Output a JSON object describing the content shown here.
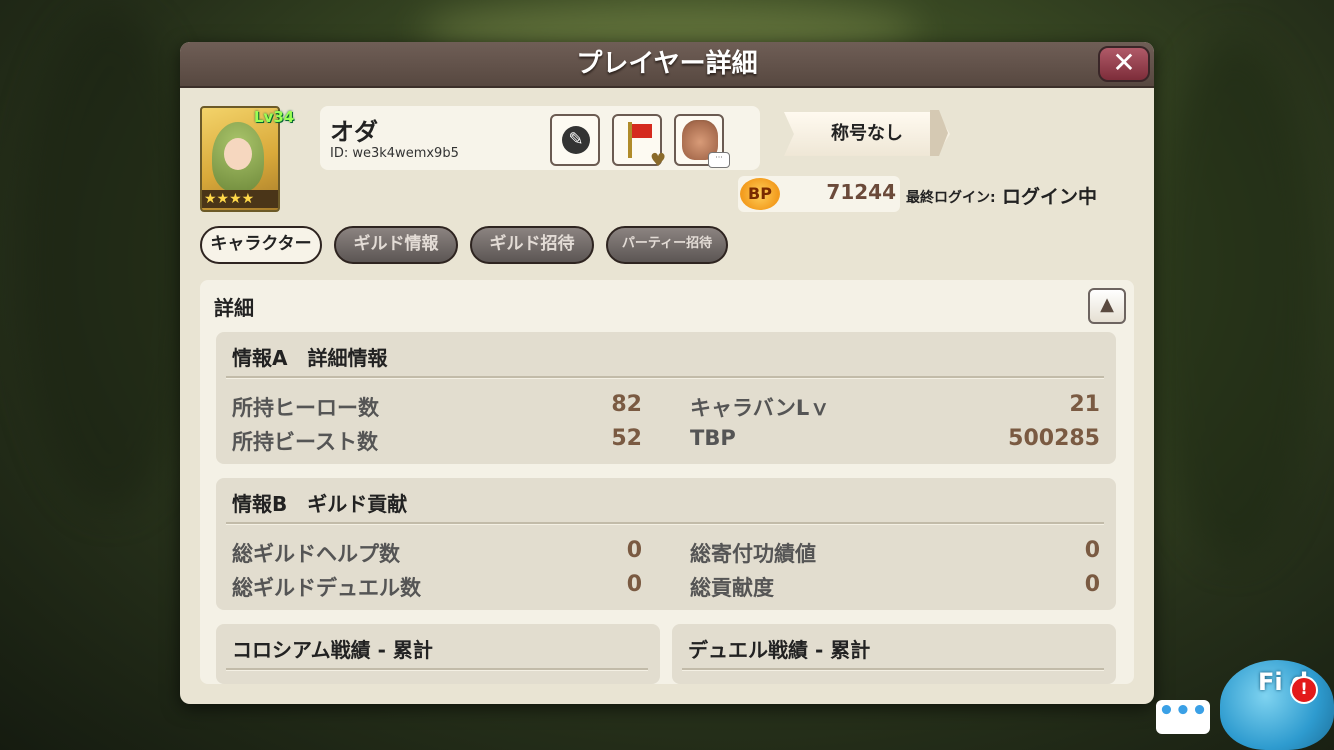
{
  "dialog": {
    "title": "プレイヤー詳細",
    "close_label": "✕"
  },
  "player": {
    "level_badge": "Lv34",
    "stars": "★★★★",
    "name": "オダ",
    "id": "ID: we3k4wemx9b5",
    "title_badge": "称号なし",
    "bp_icon": "BP",
    "bp_value": "71244",
    "login_label": "最終ログイン:",
    "login_status": "ログイン中"
  },
  "action_icons": [
    "pen-icon",
    "guild-flag-icon",
    "chat-portrait-icon"
  ],
  "tabs": [
    {
      "label": "キャラクター",
      "active": true
    },
    {
      "label": "ギルド情報",
      "active": false
    },
    {
      "label": "ギルド招待",
      "active": false
    },
    {
      "label": "パーティー招待",
      "active": false
    }
  ],
  "details": {
    "label": "詳細",
    "collapse_label": "▲",
    "info_a": {
      "header": "情報A　詳細情報",
      "stats": [
        {
          "label": "所持ヒーロー数",
          "value": "82"
        },
        {
          "label": "所持ビースト数",
          "value": "52"
        },
        {
          "label": "キャラバンLｖ",
          "value": "21"
        },
        {
          "label": "TBP",
          "value": "500285"
        }
      ]
    },
    "info_b": {
      "header": "情報B　ギルド貢献",
      "stats": [
        {
          "label": "総ギルドヘルプ数",
          "value": "0"
        },
        {
          "label": "総ギルドデュエル数",
          "value": "0"
        },
        {
          "label": "総寄付功績値",
          "value": "0"
        },
        {
          "label": "総貢献度",
          "value": "0"
        }
      ]
    },
    "colosseum_header": "コロシアム戦績 - 累計",
    "duel_header": "デュエル戦績 - 累計"
  },
  "overlay": {
    "chat_label": "•••",
    "mascot_label": "Fi d",
    "alert_label": "!"
  },
  "colors": {
    "title_bar": "#574840",
    "panel_bg": "#e9e4d3",
    "value_brown": "#7a5a42",
    "close_red": "#7d2d3a"
  }
}
